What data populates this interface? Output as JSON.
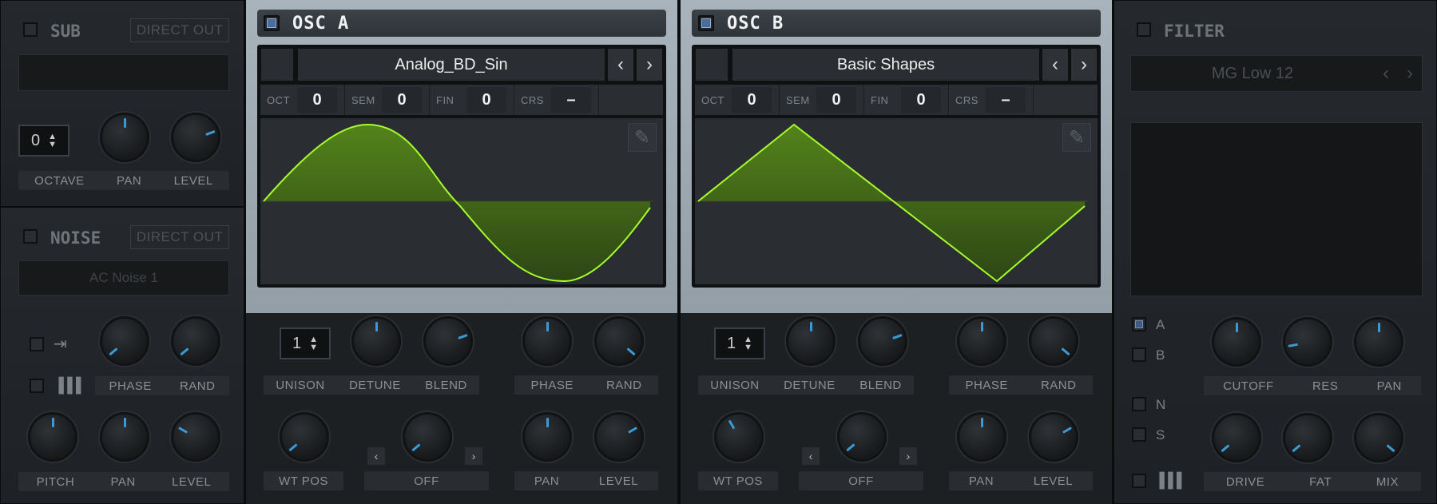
{
  "sub": {
    "title": "SUB",
    "direct_out": "DIRECT OUT",
    "octave_value": "0",
    "labels": [
      "OCTAVE",
      "PAN",
      "LEVEL"
    ]
  },
  "noise": {
    "title": "NOISE",
    "direct_out": "DIRECT OUT",
    "preset": "AC Noise 1",
    "labels_row1": [
      "PHASE",
      "RAND"
    ],
    "labels_row2": [
      "PITCH",
      "PAN",
      "LEVEL"
    ]
  },
  "osc_a": {
    "title": "OSC A",
    "preset": "Analog_BD_Sin",
    "params": [
      {
        "label": "OCT",
        "value": "0"
      },
      {
        "label": "SEM",
        "value": "0"
      },
      {
        "label": "FIN",
        "value": "0"
      },
      {
        "label": "CRS",
        "value": "–"
      }
    ],
    "unison": "1",
    "labels_row1": [
      "UNISON",
      "DETUNE",
      "BLEND",
      "PHASE",
      "RAND"
    ],
    "labels_row2": [
      "WT POS",
      "OFF",
      "PAN",
      "LEVEL"
    ]
  },
  "osc_b": {
    "title": "OSC B",
    "preset": "Basic Shapes",
    "params": [
      {
        "label": "OCT",
        "value": "0"
      },
      {
        "label": "SEM",
        "value": "0"
      },
      {
        "label": "FIN",
        "value": "0"
      },
      {
        "label": "CRS",
        "value": "–"
      }
    ],
    "unison": "1",
    "labels_row1": [
      "UNISON",
      "DETUNE",
      "BLEND",
      "PHASE",
      "RAND"
    ],
    "labels_row2": [
      "WT POS",
      "OFF",
      "PAN",
      "LEVEL"
    ]
  },
  "filter": {
    "title": "FILTER",
    "preset": "MG Low 12",
    "routes": [
      "A",
      "B",
      "N",
      "S"
    ],
    "labels_row1": [
      "CUTOFF",
      "RES",
      "PAN"
    ],
    "labels_row2": [
      "DRIVE",
      "FAT",
      "MIX"
    ]
  },
  "icons": {
    "prev": "chevron-left-icon",
    "next": "chevron-right-icon",
    "edit": "pencil-icon",
    "keytrack": "piano-keys-icon",
    "retrigger": "arrow-right-bar-icon"
  },
  "colors": {
    "wave_fill": "#4a7a12",
    "wave_line": "#a6ff2b",
    "knob_indicator": "#3b9ad6",
    "active_toggle": "#4b6d9a"
  }
}
